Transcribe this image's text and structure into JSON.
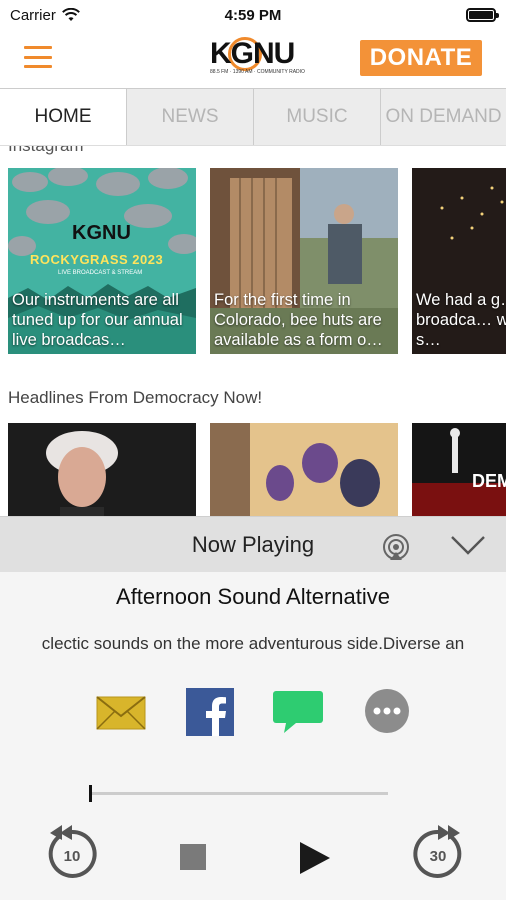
{
  "status_bar": {
    "carrier": "Carrier",
    "time": "4:59 PM"
  },
  "header": {
    "logo_text": "KGNU",
    "logo_sub": "88.5 FM · 1390 AM · COMMUNITY RADIO",
    "donate_label": "DONATE"
  },
  "tabs": [
    {
      "label": "HOME",
      "active": true
    },
    {
      "label": "NEWS",
      "active": false
    },
    {
      "label": "MUSIC",
      "active": false
    },
    {
      "label": "ON DEMAND",
      "active": false
    }
  ],
  "instagram": {
    "section_label": "Instagram",
    "cards": [
      {
        "caption": "Our instruments are all tuned up for our annual live broadcas…",
        "art_title": "KGNU",
        "art_subtitle": "ROCKYGRASS 2023",
        "art_note": "LIVE BROADCAST & STREAM"
      },
      {
        "caption": "For the first time in Colorado, bee huts are available as a form o…"
      },
      {
        "caption": "We had a g… live broadca… wonderful s…"
      }
    ]
  },
  "headlines": {
    "section_label": "Headlines From Democracy Now!",
    "cards": [
      {
        "label": "headline-1"
      },
      {
        "label": "headline-2"
      },
      {
        "label": "headline-3",
        "art_text": "DEM"
      }
    ]
  },
  "now_playing": {
    "header_label": "Now Playing",
    "show_title": "Afternoon Sound Alternative",
    "show_desc": "clectic sounds on the more adventurous side.Diverse an",
    "progress": 0.0
  },
  "share": {
    "email": "email-icon",
    "facebook": "facebook-icon",
    "message": "message-icon",
    "more": "more-icon"
  },
  "controls": {
    "rewind_seconds": "10",
    "forward_seconds": "30"
  },
  "colors": {
    "accent": "#f08a2c",
    "donate_bg": "#f39238",
    "facebook": "#3b5998",
    "message": "#2ecc71",
    "email": "#d9b52a"
  }
}
